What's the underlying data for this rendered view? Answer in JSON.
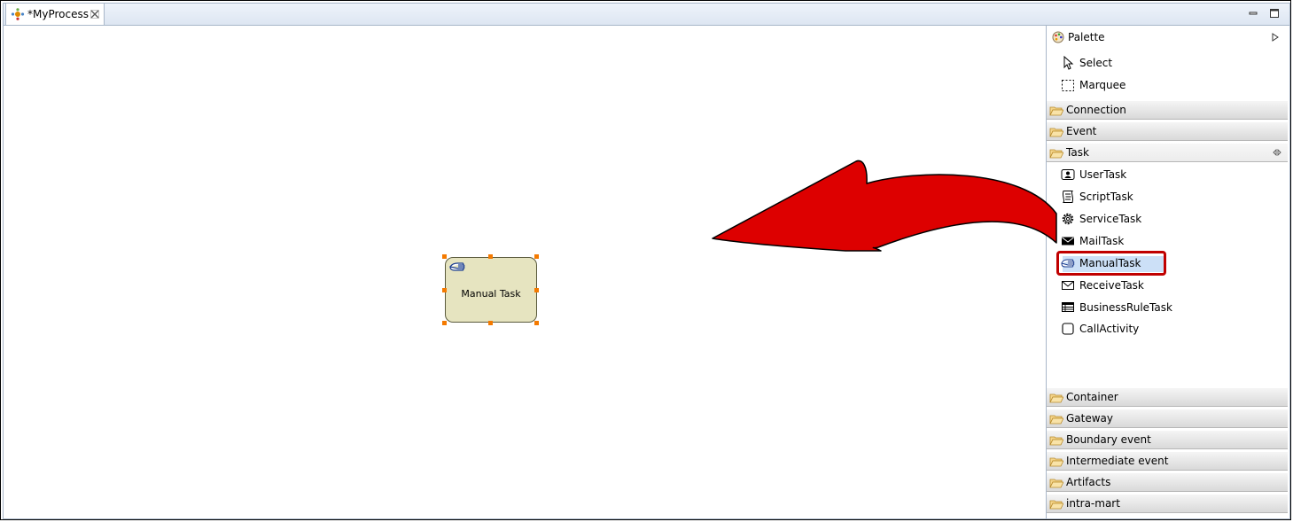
{
  "editor": {
    "tab_title": "*MyProcess"
  },
  "canvas": {
    "task_node_label": "Manual Task",
    "task_node_icon": "hand-icon"
  },
  "palette": {
    "title": "Palette",
    "tools": [
      {
        "label": "Select",
        "icon": "arrow-cursor-icon"
      },
      {
        "label": "Marquee",
        "icon": "marquee-icon"
      }
    ],
    "drawers_top": [
      {
        "label": "Connection"
      },
      {
        "label": "Event"
      },
      {
        "label": "Task"
      }
    ],
    "task_items": [
      {
        "label": "UserTask",
        "icon": "user-task-icon"
      },
      {
        "label": "ScriptTask",
        "icon": "script-icon"
      },
      {
        "label": "ServiceTask",
        "icon": "gear-icon"
      },
      {
        "label": "MailTask",
        "icon": "mail-filled-icon"
      },
      {
        "label": "ManualTask",
        "icon": "hand-icon",
        "selected": true
      },
      {
        "label": "ReceiveTask",
        "icon": "envelope-icon"
      },
      {
        "label": "BusinessRuleTask",
        "icon": "table-icon"
      },
      {
        "label": "CallActivity",
        "icon": "rounded-square-icon"
      }
    ],
    "drawers_bottom": [
      {
        "label": "Container"
      },
      {
        "label": "Gateway"
      },
      {
        "label": "Boundary event"
      },
      {
        "label": "Intermediate event"
      },
      {
        "label": "Artifacts"
      },
      {
        "label": "intra-mart"
      }
    ]
  },
  "colors": {
    "annotation_arrow": "#dd0000",
    "highlight_border": "#c00000",
    "task_fill": "#e6e4c0",
    "selection_handle": "#f47a00"
  }
}
